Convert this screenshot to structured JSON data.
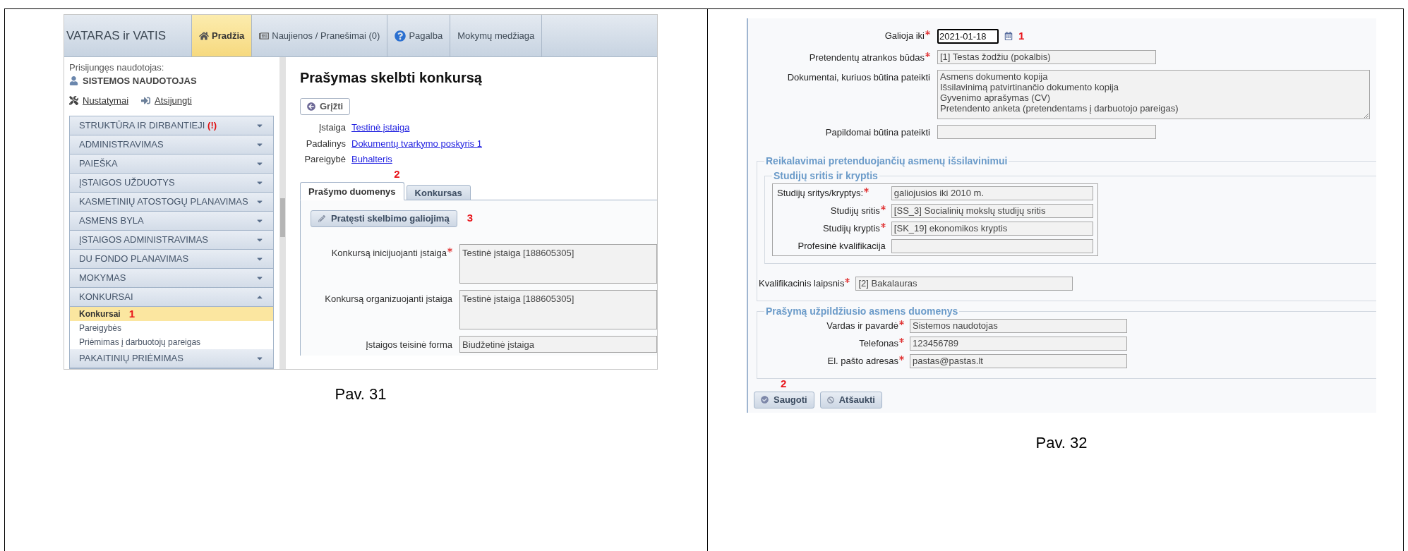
{
  "left_cell": {
    "app": {
      "logo": "VATARAS ir VATIS",
      "nav_tabs": [
        {
          "label": "Pradžia",
          "selected": true
        },
        {
          "label": "Naujienos / Pranešimai (0)",
          "selected": false
        },
        {
          "label": "Pagalba",
          "selected": false
        },
        {
          "label": "Mokymų medžiaga",
          "selected": false
        }
      ],
      "sidebar": {
        "user_label": "Prisijungęs naudotojas:",
        "user_name": "SISTEMOS NAUDOTOJAS",
        "links": [
          {
            "label": "Nustatymai"
          },
          {
            "label": "Atsijungti"
          }
        ],
        "menu": [
          {
            "label": "STRUKTŪRA IR DIRBANTIEJI",
            "alert": "(!)",
            "expanded": false
          },
          {
            "label": "ADMINISTRAVIMAS",
            "expanded": false
          },
          {
            "label": "PAIEŠKA",
            "expanded": false
          },
          {
            "label": "ĮSTAIGOS UŽDUOTYS",
            "expanded": false
          },
          {
            "label": "KASMETINIŲ ATOSTOGŲ PLANAVIMAS",
            "expanded": false
          },
          {
            "label": "ASMENS BYLA",
            "expanded": false
          },
          {
            "label": "ĮSTAIGOS ADMINISTRAVIMAS",
            "expanded": false
          },
          {
            "label": "DU FONDO PLANAVIMAS",
            "expanded": false
          },
          {
            "label": "MOKYMAS",
            "expanded": false
          },
          {
            "label": "KONKURSAI",
            "expanded": true,
            "children": [
              {
                "label": "Konkursai",
                "selected": true,
                "annotation": "1"
              },
              {
                "label": "Pareigybės",
                "selected": false
              },
              {
                "label": "Priėmimas į darbuotojų pareigas",
                "selected": false
              }
            ]
          },
          {
            "label": "PAKAITINIŲ PRIĖMIMAS",
            "expanded": false
          }
        ]
      },
      "main": {
        "title": "Prašymas skelbti konkursą",
        "back_button": "Grįžti",
        "info": [
          {
            "label": "Įstaiga",
            "value": "Testinė įstaiga"
          },
          {
            "label": "Padalinys",
            "value": "Dokumentų tvarkymo poskyris 1"
          },
          {
            "label": "Pareigybė",
            "value": "Buhalteris"
          }
        ],
        "tabs": [
          {
            "label": "Prašymo duomenys",
            "selected": true,
            "annotation": "2"
          },
          {
            "label": "Konkursas",
            "selected": false
          }
        ],
        "extend_button": {
          "label": "Pratęsti skelbimo galiojimą",
          "annotation": "3"
        },
        "fields": [
          {
            "label": "Konkursą inicijuojanti įstaiga",
            "required": true,
            "value": "Testinė įstaiga [188605305]"
          },
          {
            "label": "Konkursą organizuojanti įstaiga",
            "required": false,
            "value": "Testinė įstaiga [188605305]"
          },
          {
            "label": "Įstaigos teisinė forma",
            "required": false,
            "value": "Biudžetinė įstaiga"
          }
        ]
      }
    },
    "caption": "Pav. 31"
  },
  "right_cell": {
    "form": {
      "fields": [
        {
          "kind": "date",
          "label": "Galioja iki",
          "required": true,
          "value": "2021-01-18",
          "annotation": "1"
        },
        {
          "kind": "text",
          "label": "Pretendentų atrankos būdas",
          "required": true,
          "value": "[1] Testas žodžiu (pokalbis)"
        },
        {
          "kind": "textarea",
          "label": "Dokumentai, kuriuos būtina pateikti",
          "required": false,
          "lines": [
            "Asmens dokumento kopija",
            "Išsilavinimą patvirtinančio dokumento kopija",
            "Gyvenimo aprašymas (CV)",
            "Pretendento anketa (pretendentams į darbuotojo pareigas)"
          ]
        },
        {
          "kind": "text",
          "label": "Papildomai būtina pateikti",
          "required": false
        }
      ],
      "education": {
        "legend": "Reikalavimai pretenduojančių asmenų išsilavinimui",
        "study": {
          "legend": "Studijų sritis ir kryptis",
          "rows": [
            {
              "label": "Studijų sritys/kryptys:",
              "required": true,
              "value": "galiojusios iki 2010 m."
            },
            {
              "label": "Studijų sritis",
              "required": true,
              "value": "[SS_3] Socialinių mokslų studijų sritis"
            },
            {
              "label": "Studijų kryptis",
              "required": true,
              "value": "[SK_19] ekonomikos kryptis"
            },
            {
              "label": "Profesinė kvalifikacija",
              "required": false
            }
          ]
        },
        "degree": {
          "label": "Kvalifikacinis laipsnis",
          "required": true,
          "value": "[2] Bakalauras"
        }
      },
      "applicant": {
        "legend": "Prašymą užpildžiusio asmens duomenys",
        "rows": [
          {
            "label": "Vardas ir pavardė",
            "required": true,
            "value": "Sistemos naudotojas"
          },
          {
            "label": "Telefonas",
            "required": true,
            "value": "123456789"
          },
          {
            "label": "El. pašto adresas",
            "required": true,
            "value": "pastas@pastas.lt"
          }
        ]
      },
      "buttons": [
        {
          "label": "Saugoti",
          "annotation": "2"
        },
        {
          "label": "Atšaukti"
        }
      ]
    },
    "caption": "Pav. 32"
  }
}
